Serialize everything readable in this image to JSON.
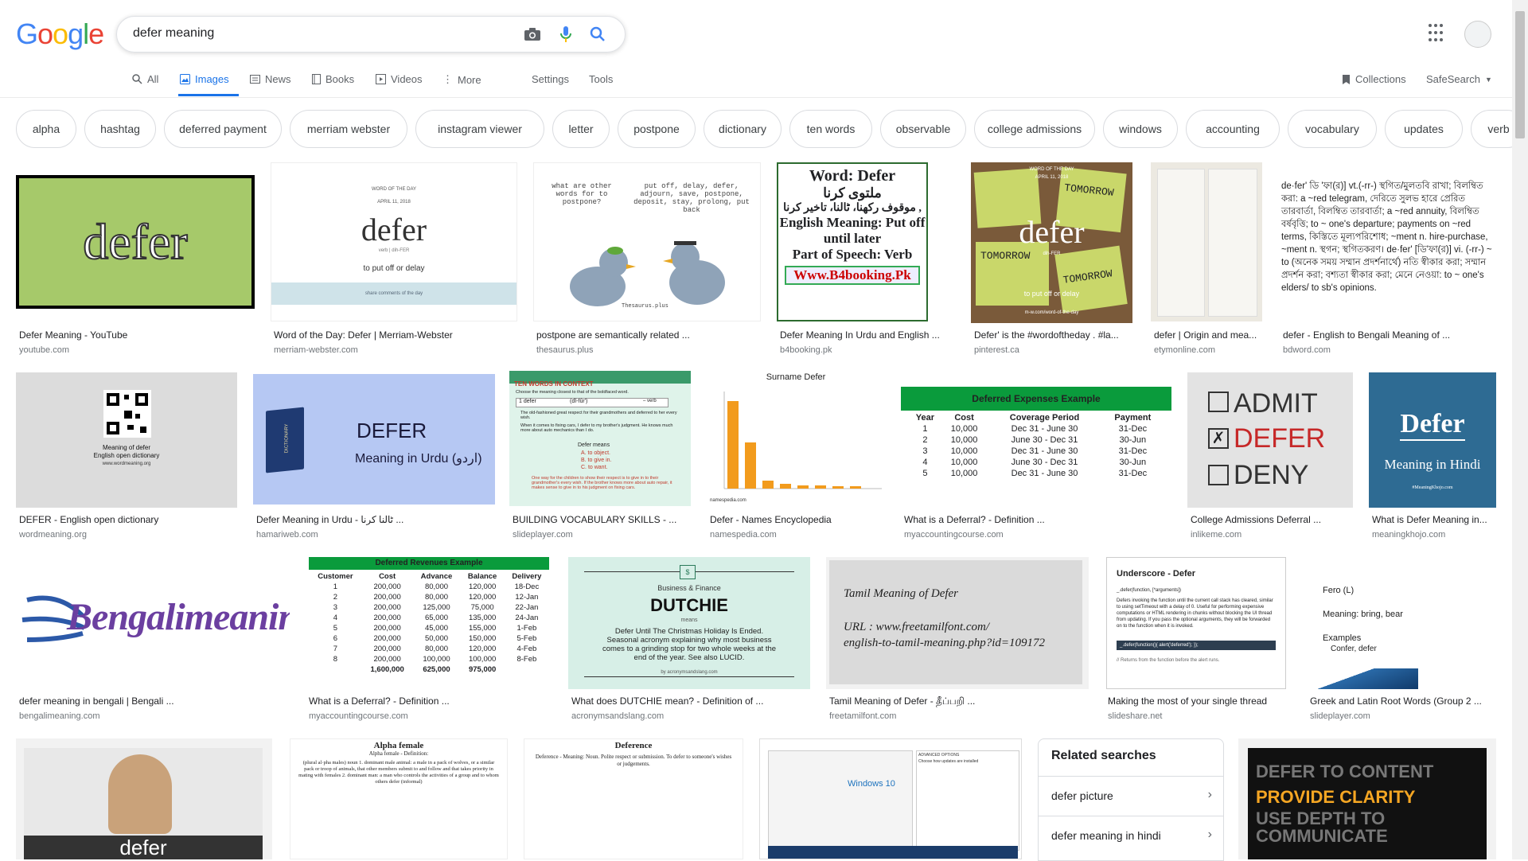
{
  "logo": {
    "letters": [
      "G",
      "o",
      "o",
      "g",
      "l",
      "e"
    ]
  },
  "search": {
    "query": "defer meaning"
  },
  "tabs": {
    "all": "All",
    "images": "Images",
    "news": "News",
    "books": "Books",
    "videos": "Videos",
    "more": "More",
    "settings": "Settings",
    "tools": "Tools",
    "collections": "Collections",
    "safesearch": "SafeSearch"
  },
  "chips": [
    "alpha",
    "hashtag",
    "deferred payment",
    "merriam webster",
    "instagram viewer",
    "letter",
    "postpone",
    "dictionary",
    "ten words",
    "observable",
    "college admissions",
    "windows",
    "accounting",
    "vocabulary",
    "updates",
    "verb"
  ],
  "results": [
    {
      "caption": "Defer Meaning - YouTube",
      "source": "youtube.com"
    },
    {
      "caption": "Word of the Day: Defer | Merriam-Webster",
      "source": "merriam-webster.com"
    },
    {
      "caption": "postpone are semantically related ...",
      "source": "thesaurus.plus"
    },
    {
      "caption": "Defer Meaning In Urdu and English ...",
      "source": "b4booking.pk"
    },
    {
      "caption": "Defer' is the #wordoftheday . #la...",
      "source": "pinterest.ca"
    },
    {
      "caption": "defer | Origin and mea...",
      "source": "etymonline.com"
    },
    {
      "caption": "defer - English to Bengali Meaning of ...",
      "source": "bdword.com"
    },
    {
      "caption": "DEFER - English open dictionary",
      "source": "wordmeaning.org"
    },
    {
      "caption": "Defer Meaning in Urdu - ٹالنا کرنا ...",
      "source": "hamariweb.com"
    },
    {
      "caption": "BUILDING VOCABULARY SKILLS - ...",
      "source": "slideplayer.com"
    },
    {
      "caption": "Defer - Names Encyclopedia",
      "source": "namespedia.com"
    },
    {
      "caption": "What is a Deferral? - Definition ...",
      "source": "myaccountingcourse.com"
    },
    {
      "caption": "College Admissions Deferral ...",
      "source": "inlikeme.com"
    },
    {
      "caption": "What is Defer Meaning in...",
      "source": "meaningkhojo.com"
    },
    {
      "caption": "defer meaning in bengali | Bengali ...",
      "source": "bengalimeaning.com"
    },
    {
      "caption": "What is a Deferral? - Definition ...",
      "source": "myaccountingcourse.com"
    },
    {
      "caption": "What does DUTCHIE mean? - Definition of ...",
      "source": "acronymsandslang.com"
    },
    {
      "caption": "Tamil Meaning of Defer - தீப்பறி ...",
      "source": "freetamilfont.com"
    },
    {
      "caption": "Making the most of your single thread",
      "source": "slideshare.net"
    },
    {
      "caption": "Greek and Latin Root Words (Group 2 ...",
      "source": "slideplayer.com"
    }
  ],
  "thumbs": {
    "defer_word": "defer",
    "mw_label": "WORD OF THE DAY",
    "mw_date": "APRIL 11, 2018",
    "mw_word": "defer",
    "mw_pron": "verb | dih-FER",
    "mw_def": "to put off or delay",
    "mw_footer": "share comments of the day",
    "thes_q": "what are other words for to postpone?",
    "thes_a": "put off, delay, defer, adjourn, save, postpone, deposit, stay, prolong, put back",
    "thes_brand": "Thesaurus.plus",
    "b4_1": "Word: Defer",
    "b4_2": "ملتوی کرنا",
    "b4_3": "موقوف رکھنا، ٹالنا، تاخیر کرنا ,",
    "b4_4": "English Meaning: Put off",
    "b4_5": "until later",
    "b4_6": "Part of Speech: Verb",
    "b4_7": "Www.B4booking.Pk",
    "pin_word": "defer",
    "pin_tomorrow": "TOMORROW",
    "pin_top": "WORD OF THE DAY",
    "pin_date": "APRIL 11, 2018",
    "pin_pron": "dih-FER",
    "pin_def": "to put off or delay",
    "pin_site": "m-w.com/word-of-the-day",
    "bd_text": "de·fer' ডি 'ফা(র)] vt.(-rr-) স্থগিত/মুলতবি রাখা; বিলম্বিত করা: a ~red telegram, দেরিতে সুলভ হারে প্রেরিত তারবার্তা, বিলম্বিত তারবার্তা; a ~red annuity, বিলম্বিত বর্ষবৃত্তি; to ~ one's departure; payments on ~red terms, কিস্তিতে মূল্যপরিশোধ; ~ment n. hire-purchase, ~ment n. স্থগন; স্থগিতকরণ। de·fer' [ডি'ফা(র)] vi. (-rr-) ~ to (অনেক সময় সম্মান প্রদর্শনার্থে) নতি স্বীকার করা; সম্মান প্রদর্শন করা; বশ্যতা স্বীকার করা; মেনে নেওয়া: to ~ one's elders/ to sb's opinions.",
    "wm_1": "Meaning of defer",
    "wm_2": "English open dictionary",
    "wm_3": "www.wordmeaning.org",
    "hw_book": "DICTIONARY",
    "hw_title": "DEFER",
    "hw_sub": "Meaning in Urdu (اردو)",
    "sp_title": "TEN WORDS IN CONTEXT",
    "sp_intro": "Choose the meaning closest to that of the boldfaced word.",
    "sp_word": "1  defer",
    "sp_pron": "(dĭ-fûr')",
    "sp_pos": "– verb",
    "sp_b1": "The old-fashioned great respect for their grandmothers and deferred to her every wish.",
    "sp_b2": "When it comes to fixing cars, I defer to my brother's judgment. He knows much more about auto mechanics than I do.",
    "sp_defer": "Defer means",
    "sp_a": "A. to object.",
    "sp_b": "B. to give in.",
    "sp_c": "C. to want.",
    "sp_foot": "One way for the children to show their respect is to give in to their grandmother's every wish. If the brother knows more about auto repair, it makes sense to give in to his judgment on fixing cars.",
    "nm_title": "Surname Defer",
    "nm_site": "namespedia.com",
    "ma_title": "Deferred Expenses Example",
    "ma_headers": [
      "Year",
      "Cost",
      "Coverage Period",
      "Payment"
    ],
    "ma_rows": [
      [
        "1",
        "10,000",
        "Dec 31 - June 30",
        "31-Dec"
      ],
      [
        "2",
        "10,000",
        "June 30 - Dec 31",
        "30-Jun"
      ],
      [
        "3",
        "10,000",
        "Dec 31 - June 30",
        "31-Dec"
      ],
      [
        "4",
        "10,000",
        "June 30 - Dec 31",
        "30-Jun"
      ],
      [
        "5",
        "10,000",
        "Dec 31 - June 30",
        "31-Dec"
      ]
    ],
    "ad_1": "ADMIT",
    "ad_2": "DEFER",
    "ad_3": "DENY",
    "mk_title": "Defer",
    "mk_sub": "Meaning in Hindi",
    "mk_tag": "#MeaningKhojo.com",
    "bm_text": "Bengalimeaning.com",
    "dr_title": "Deferred Revenues Example",
    "dr_headers": [
      "Customer",
      "Cost",
      "Advance",
      "Balance",
      "Delivery"
    ],
    "dr_rows": [
      [
        "1",
        "200,000",
        "80,000",
        "120,000",
        "18-Dec"
      ],
      [
        "2",
        "200,000",
        "80,000",
        "120,000",
        "12-Jan"
      ],
      [
        "3",
        "200,000",
        "125,000",
        "75,000",
        "22-Jan"
      ],
      [
        "4",
        "200,000",
        "65,000",
        "135,000",
        "24-Jan"
      ],
      [
        "5",
        "200,000",
        "45,000",
        "155,000",
        "1-Feb"
      ],
      [
        "6",
        "200,000",
        "50,000",
        "150,000",
        "5-Feb"
      ],
      [
        "7",
        "200,000",
        "80,000",
        "120,000",
        "4-Feb"
      ],
      [
        "8",
        "200,000",
        "100,000",
        "100,000",
        "8-Feb"
      ],
      [
        "",
        "1,600,000",
        "625,000",
        "975,000",
        ""
      ]
    ],
    "du_cat": "Business & Finance",
    "du_word": "DUTCHIE",
    "du_means": "means",
    "du_def": "Defer Until The Christmas Holiday Is Ended. Seasonal acronym explaining why most business comes to a grinding stop for two whole weeks at the end of the year. See also LUCID.",
    "du_site": "by acronymsandslang.com",
    "ta_1": "Tamil Meaning of Defer",
    "ta_2": "URL : www.freetamilfont.com/",
    "ta_3": "english-to-tamil-meaning.php?id=109172",
    "us_title": "Underscore - Defer",
    "us_sig": "_.defer(function, [*arguments])",
    "us_body": "Defers invoking the function until the current call stack has cleared, similar to using setTimeout with a delay of 0. Useful for performing expensive computations or HTML rendering in chunks without blocking the UI thread from updating. If you pass the optional arguments, they will be forwarded on to the function when it is invoked.",
    "us_code": "_.defer(function(){ alert('deferred'); });",
    "us_note": "// Returns from the function before the alert runs.",
    "gr_1": "Fero (L)",
    "gr_2": "Meaning: bring, bear",
    "gr_3": "Examples",
    "gr_4": "Confer, defer",
    "vid_word": "defer",
    "af_title": "Alpha female",
    "af_sub": "Alpha female - Definition:",
    "af_body": "(plural al·pha males) noun 1. dominant male animal: a male in a pack of wolves, or a similar pack or troop of animals, that other members submit to and follow and that takes priority in mating with females 2. dominant man: a man who controls the activities of a group and to whom others defer (informal)",
    "dfc_title": "Deference",
    "dfc_body": "Deference - Meaning: Noun. Polite respect or submission. To defer to someone's wishes or judgements.",
    "w10_brand": "Windows 10",
    "w10_title": "ADVANCED OPTIONS",
    "w10_body": "Choose how updates are installed",
    "dc_1": "DEFER TO CONTENT",
    "dc_2": "PROVIDE CLARITY",
    "dc_3": "USE DEPTH TO",
    "dc_4": "COMMUNICATE"
  },
  "related": {
    "title": "Related searches",
    "items": [
      "defer picture",
      "defer meaning in hindi"
    ]
  },
  "colors": {
    "accent": "#1a73e8",
    "green": "#00a14b",
    "dark_green_card": "#a6c96a"
  }
}
